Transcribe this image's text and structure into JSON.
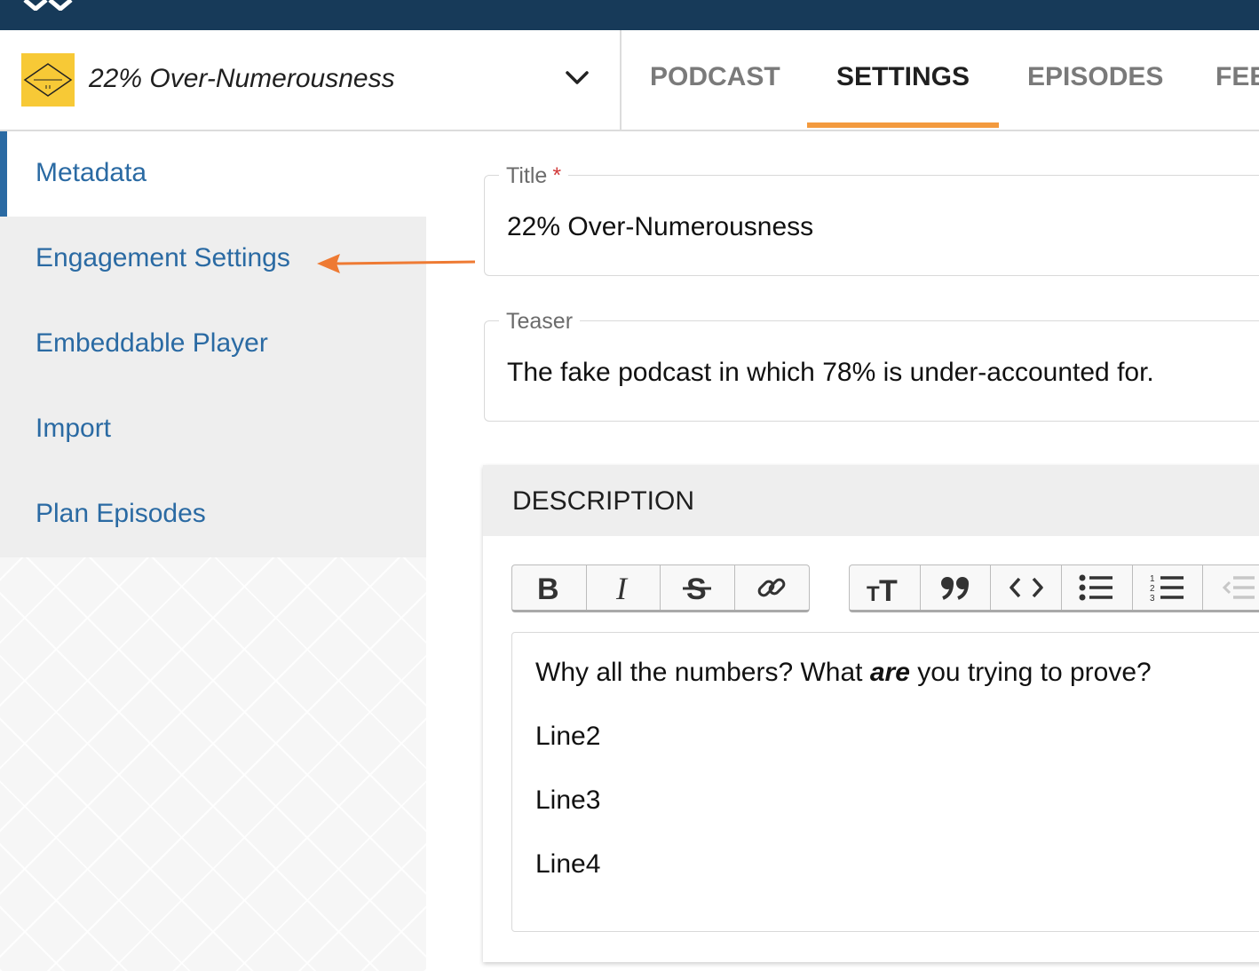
{
  "header": {
    "podcast_name": "22% Over-Numerousness",
    "tabs": [
      {
        "label": "PODCAST"
      },
      {
        "label": "SETTINGS"
      },
      {
        "label": "EPISODES"
      },
      {
        "label": "FEE"
      }
    ],
    "active_tab": "SETTINGS"
  },
  "sidebar": {
    "items": [
      {
        "label": "Metadata"
      },
      {
        "label": "Engagement Settings"
      },
      {
        "label": "Embeddable Player"
      },
      {
        "label": "Import"
      },
      {
        "label": "Plan Episodes"
      }
    ],
    "active_item": "Metadata"
  },
  "form": {
    "title_label": "Title",
    "title_required_mark": "*",
    "title_value": "22% Over-Numerousness",
    "teaser_label": "Teaser",
    "teaser_value": "The fake podcast in which 78% is under-accounted for."
  },
  "description": {
    "heading": "DESCRIPTION",
    "toolbar": [
      "bold-icon",
      "italic-icon",
      "strikethrough-icon",
      "link-icon",
      "text-size-icon",
      "quote-icon",
      "code-icon",
      "bullet-list-icon",
      "numbered-list-icon",
      "outdent-icon"
    ],
    "line1_before": "Why all the numbers? What ",
    "line1_emphasis": "are",
    "line1_after": " you trying to prove?",
    "line2": "Line2",
    "line3": "Line3",
    "line4": "Line4"
  },
  "colors": {
    "topbar": "#173a59",
    "accent_orange": "#f39a3e",
    "link_blue": "#2a6aa3",
    "logo_yellow": "#f7c936"
  }
}
